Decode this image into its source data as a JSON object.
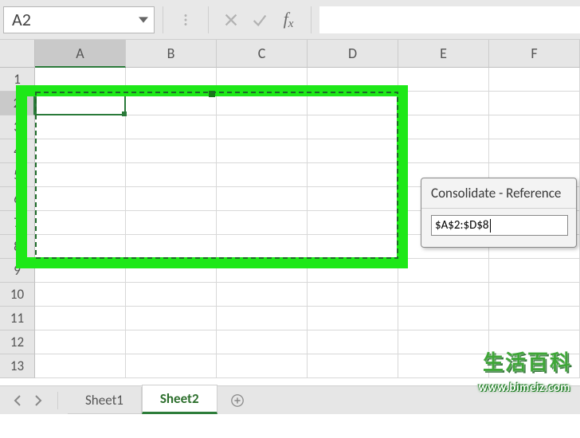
{
  "formula_bar": {
    "name_box": "A2",
    "formula": ""
  },
  "columns": [
    "A",
    "B",
    "C",
    "D",
    "E",
    "F"
  ],
  "active_column": "A",
  "rows": [
    "1",
    "2",
    "3",
    "4",
    "5",
    "6",
    "7",
    "8",
    "9",
    "10",
    "11",
    "12",
    "13"
  ],
  "active_row": "2",
  "selection": {
    "ref": "A2:D8"
  },
  "dialog": {
    "title": "Consolidate - Reference",
    "reference": "$A$2:$D$8"
  },
  "tabs": {
    "items": [
      {
        "label": "Sheet1",
        "active": false
      },
      {
        "label": "Sheet2",
        "active": true
      }
    ]
  },
  "watermark": {
    "main": "生活百科",
    "url": "www.bimeiz.com"
  },
  "colors": {
    "accent": "#2d7d3a",
    "highlight": "#1ee818"
  }
}
